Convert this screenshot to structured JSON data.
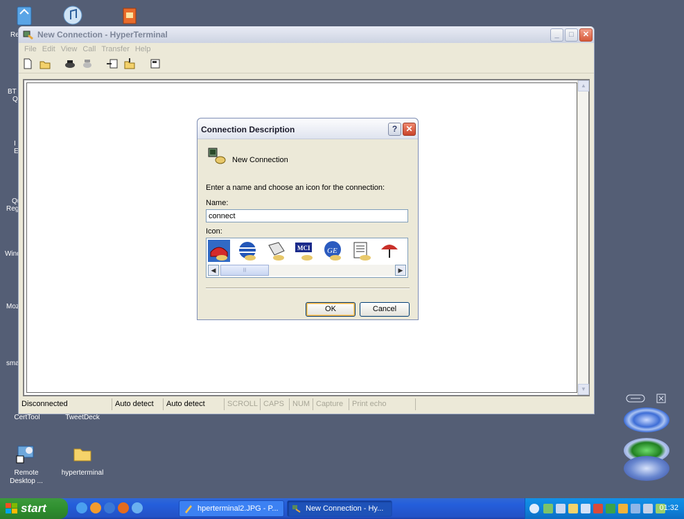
{
  "desktop": {
    "icons": [
      {
        "label": "CertTool"
      },
      {
        "label": "TweetDeck"
      },
      {
        "label": "Remote Desktop ..."
      },
      {
        "label": "hyperterminal"
      }
    ],
    "edge_labels": [
      "Re",
      "BT",
      "Q",
      "I",
      "E",
      "Qu",
      "Reg",
      "Wind",
      "Moz",
      "sma"
    ]
  },
  "window": {
    "title": "New Connection - HyperTerminal",
    "menu": [
      "File",
      "Edit",
      "View",
      "Call",
      "Transfer",
      "Help"
    ],
    "toolbar_icons": [
      "new-icon",
      "open-icon",
      "dial-icon",
      "disconnect-icon",
      "send-icon",
      "receive-icon",
      "properties-icon"
    ],
    "status": {
      "connection": "Disconnected",
      "detect1": "Auto detect",
      "detect2": "Auto detect",
      "scroll": "SCROLL",
      "caps": "CAPS",
      "num": "NUM",
      "capture": "Capture",
      "print_echo": "Print echo"
    }
  },
  "dialog": {
    "title": "Connection Description",
    "help": "?",
    "header_label": "New Connection",
    "instruction": "Enter a name and choose an icon for the connection:",
    "name_label": "Name:",
    "name_value": "connect",
    "icon_label": "Icon:",
    "icon_list": [
      "red-phone-icon",
      "globe-icon",
      "fax-icon",
      "mci-icon",
      "ge-icon",
      "document-icon",
      "umbrella-icon"
    ],
    "ok": "OK",
    "cancel": "Cancel"
  },
  "taskbar": {
    "start": "start",
    "tasks": [
      {
        "label": "hperterminal2.JPG - P...",
        "active": false
      },
      {
        "label": "New Connection - Hy...",
        "active": true
      }
    ],
    "clock": "01:32"
  },
  "colors": {
    "desktop": "#545e75",
    "taskbar": "#245edb",
    "start": "#2f8f2f"
  }
}
